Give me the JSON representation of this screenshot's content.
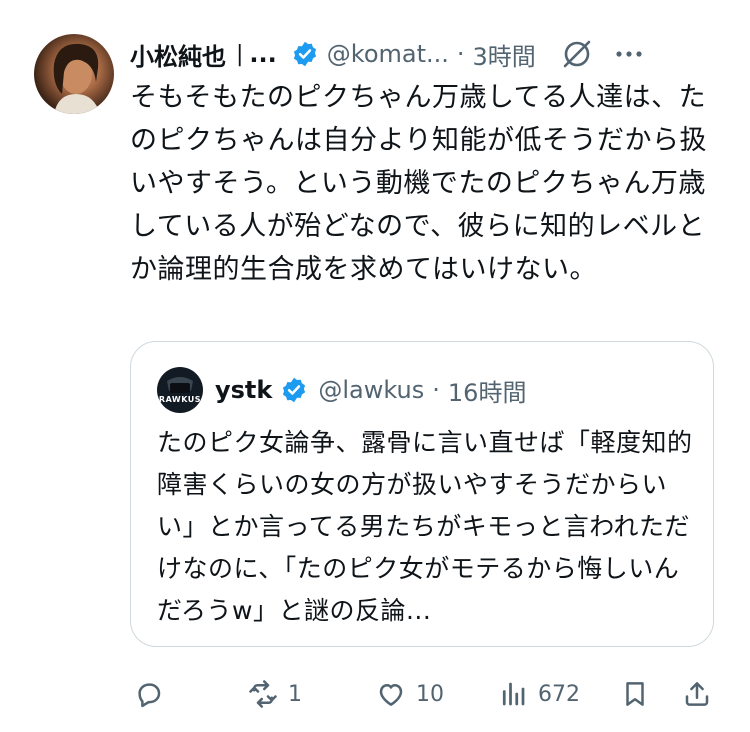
{
  "tweet": {
    "name": "小松純也",
    "name_separator": "|",
    "name_ellipsis": "...",
    "handle": "@komat...",
    "dot": "·",
    "time": "3時間",
    "text": "そもそもたのピクちゃん万歳してる人達は、たのピクちゃんは自分より知能が低そうだから扱いやすそう。という動機でたのピクちゃん万歳している人が殆どなので、彼らに知的レベルとか論理的生合成を求めてはいけない。"
  },
  "quote": {
    "avatar_text": "RAWKUS",
    "name": "ystk",
    "handle": "@lawkus",
    "dot": "·",
    "time": "16時間",
    "text": "たのピク女論争、露骨に言い直せば「軽度知的障害くらいの女の方が扱いやすそうだからいい」とか言ってる男たちがキモっと言われただけなのに、「たのピク女がモテるから悔しいんだろうw」と謎の反論..."
  },
  "actions": {
    "reply_count": "",
    "retweet_count": "1",
    "like_count": "10",
    "views_count": "672"
  },
  "colors": {
    "text": "#0f1419",
    "secondary": "#536471",
    "verified": "#1d9bf0",
    "border": "#cfd9de"
  },
  "icons": [
    "verified-badge-icon",
    "grok-icon",
    "more-icon",
    "reply-icon",
    "retweet-icon",
    "like-icon",
    "views-icon",
    "bookmark-icon",
    "share-icon"
  ]
}
